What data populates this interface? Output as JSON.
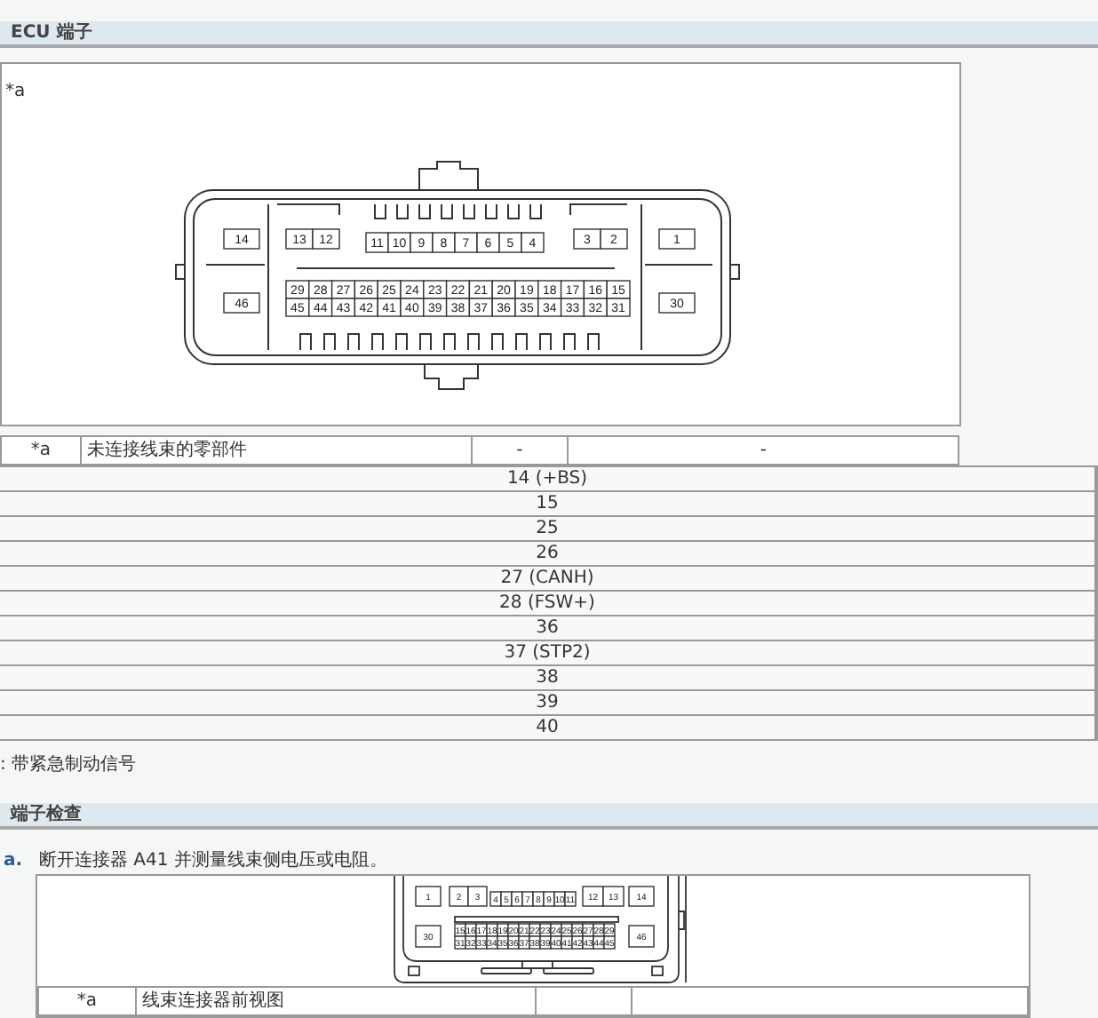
{
  "ecu_section": {
    "title": "ECU 端子",
    "figure": {
      "label": "*a",
      "pins": [
        [
          "14"
        ],
        [
          "46"
        ],
        [
          "13",
          "12"
        ],
        [
          "11",
          "10",
          "9",
          "8",
          "7",
          "6",
          "5",
          "4"
        ],
        [
          "3",
          "2"
        ],
        [
          "1"
        ],
        [
          "30"
        ],
        [
          "29",
          "28",
          "27",
          "26",
          "25",
          "24",
          "23",
          "22",
          "21",
          "20",
          "19",
          "18",
          "17",
          "16",
          "15"
        ],
        [
          "45",
          "44",
          "43",
          "42",
          "41",
          "40",
          "39",
          "38",
          "37",
          "36",
          "35",
          "34",
          "33",
          "32",
          "31"
        ]
      ]
    },
    "legend_row": [
      "*a",
      "未连接线束的零部件",
      "-",
      "-"
    ]
  },
  "terminal_list": [
    "14 (+BS)",
    "15",
    "25",
    "26",
    "27 (CANH)",
    "28 (FSW+)",
    "36",
    "37 (STP2)",
    "38",
    "39",
    "40"
  ],
  "note": ": 带紧急制动信号",
  "check_section": {
    "title": "端子检查",
    "step": {
      "marker": "a.",
      "text": "断开连接器 A41 并测量线束侧电压或电阻。"
    },
    "figure": {
      "pins": [
        [
          "1"
        ],
        [
          "30"
        ],
        [
          "2",
          "3"
        ],
        [
          "4",
          "5",
          "6",
          "7",
          "8",
          "9",
          "10",
          "11"
        ],
        [
          "12",
          "13"
        ],
        [
          "14"
        ],
        [
          "46"
        ],
        [
          "15",
          "16",
          "17",
          "18",
          "19",
          "20",
          "21",
          "22",
          "23",
          "24",
          "25",
          "26",
          "27",
          "28",
          "29"
        ],
        [
          "31",
          "32",
          "33",
          "34",
          "35",
          "36",
          "37",
          "38",
          "39",
          "40",
          "41",
          "42",
          "43",
          "44",
          "45"
        ]
      ]
    },
    "legend_row": [
      "*a",
      "线束连接器前视图"
    ]
  }
}
